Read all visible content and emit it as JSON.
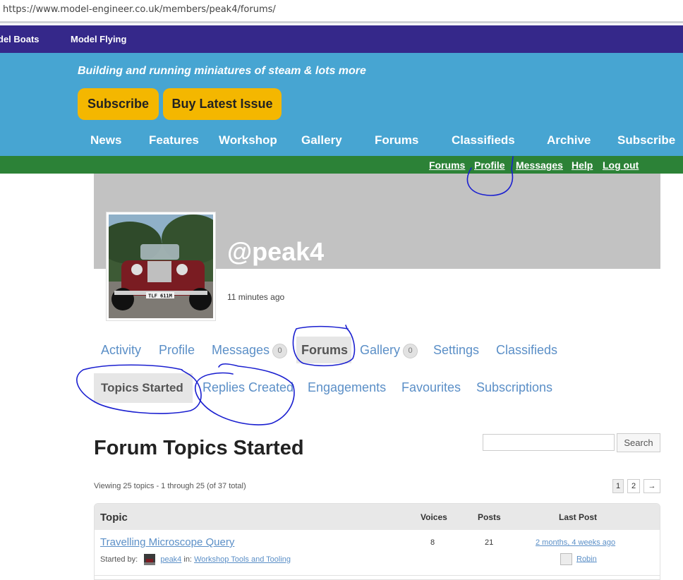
{
  "browser": {
    "url": "https://www.model-engineer.co.uk/members/peak4/forums/"
  },
  "topnav": {
    "items": [
      "del Boats",
      "Model Flying"
    ]
  },
  "hero": {
    "tagline": "Building and running miniatures of steam & lots more",
    "subscribe_label": "Subscribe",
    "buy_label": "Buy Latest Issue",
    "accent": "#f4b700",
    "background": "#47a5d2"
  },
  "mainnav": {
    "items": [
      "News",
      "Features",
      "Workshop",
      "Gallery",
      "Forums",
      "Classifieds",
      "Archive",
      "Subscribe"
    ]
  },
  "usernav": {
    "items": [
      "Forums",
      "Profile",
      "Messages",
      "Help",
      "Log out"
    ]
  },
  "profile": {
    "handle": "@peak4",
    "last_active": "11 minutes ago",
    "avatar_plate": "TLF 611M"
  },
  "profile_tabs": {
    "activity": "Activity",
    "profile": "Profile",
    "messages": "Messages",
    "messages_count": "0",
    "forums": "Forums",
    "gallery": "Gallery",
    "gallery_count": "0",
    "settings": "Settings",
    "classifieds": "Classifieds"
  },
  "sub_tabs": {
    "topics_started": "Topics Started",
    "replies_created": "Replies Created",
    "engagements": "Engagements",
    "favourites": "Favourites",
    "subscriptions": "Subscriptions"
  },
  "page": {
    "title": "Forum Topics Started",
    "search_button": "Search",
    "search_placeholder": "",
    "viewing_text": "Viewing 25 topics - 1 through 25 (of 37 total)",
    "pagination": [
      "1",
      "2",
      "→"
    ]
  },
  "table": {
    "headers": {
      "topic": "Topic",
      "voices": "Voices",
      "posts": "Posts",
      "last_post": "Last Post"
    },
    "rows": [
      {
        "title": "Travelling Microscope Query",
        "started_by_label": "Started by:",
        "author": "peak4",
        "in_label": "in:",
        "forum": "Workshop Tools and Tooling",
        "voices": "8",
        "posts": "21",
        "last_post": "2 months, 4 weeks ago",
        "last_author": "Robin"
      }
    ]
  },
  "annotation_color": "#1a1fd0"
}
